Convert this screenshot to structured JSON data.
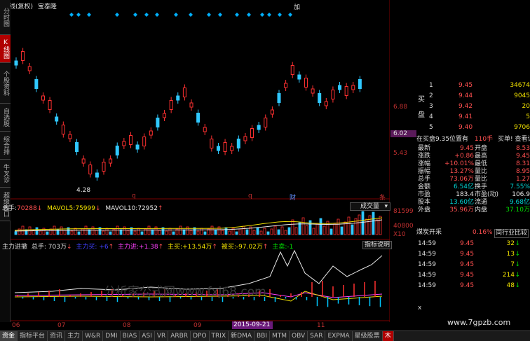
{
  "header": {
    "period_label": "日线(复权)",
    "stock_name": "宝泰隆",
    "add_button": "加"
  },
  "left_tabs": [
    {
      "label": "分时图",
      "active": false
    },
    {
      "label": "K线图",
      "active": true
    },
    {
      "label": "个股资料",
      "active": false
    },
    {
      "label": "自选股",
      "active": false
    },
    {
      "label": "综合排名",
      "active": false
    },
    {
      "label": "牛叉诊股",
      "active": false
    },
    {
      "label": "超级盘口",
      "active": false
    }
  ],
  "price_axis": {
    "levels": [
      "6.88",
      "6.02",
      "5.43"
    ],
    "current_price_highlight": "6.02",
    "low_marker": "4.28",
    "markers": [
      "q",
      "q",
      "财",
      "条"
    ]
  },
  "volume_panel": {
    "total_label": "总手:",
    "total_value": "70288",
    "mavol5_label": "MAVOL5:",
    "mavol5_value": "75999",
    "mavol10_label": "MAVOL10:",
    "mavol10_value": "72952",
    "dropdown": "成交量",
    "axis_top": "81599",
    "axis_mid": "40800",
    "axis_unit": "X10"
  },
  "indicator_panel": {
    "name": "主力进撤",
    "total": "总手: 703万",
    "main_inflow_label": "主力进:",
    "main_inflow_value": "+1.38",
    "active_buy_label": "主买:",
    "active_buy_value": "+13.54万",
    "passive_buy_label": "被买:",
    "passive_buy_value": "-97.02万",
    "main_sell_label": "主卖:",
    "main_sell_value": "-1",
    "help_button": "指标说明",
    "watermark": "分析家公式网www.fxj68.com"
  },
  "x_axis": {
    "labels": [
      "06",
      "07",
      "08",
      "09",
      "10",
      "11"
    ],
    "date_highlight": "2015-09-21"
  },
  "order_book": {
    "side_label_buy": "买",
    "side_label_sell": "卖",
    "rows": [
      {
        "n": "1",
        "price": "9.45",
        "vol": "34674"
      },
      {
        "n": "2",
        "price": "9.44",
        "vol": "9045"
      },
      {
        "n": "3",
        "price": "9.42",
        "vol": "20"
      },
      {
        "n": "4",
        "price": "9.41",
        "vol": "5"
      },
      {
        "n": "5",
        "price": "9.40",
        "vol": "9706"
      }
    ],
    "queue_text": "在买盘9.35位置有",
    "queue_vol": "110手",
    "queue_link": "买单! 查看详细"
  },
  "quote_stats": [
    {
      "l1": "最新",
      "v1": "9.45",
      "l2": "开盘",
      "v2": "8.53",
      "c1": "red",
      "c2": "red"
    },
    {
      "l1": "涨跌",
      "v1": "+0.86",
      "l2": "最高",
      "v2": "9.45",
      "c1": "red",
      "c2": "red"
    },
    {
      "l1": "涨幅",
      "v1": "+10.01%",
      "l2": "最低",
      "v2": "8.31",
      "c1": "red",
      "c2": "red"
    },
    {
      "l1": "振幅",
      "v1": "13.27%",
      "l2": "量比",
      "v2": "8.95",
      "c1": "red",
      "c2": "red"
    },
    {
      "l1": "总手",
      "v1": "73.06万",
      "l2": "量比",
      "v2": "1.27",
      "c1": "red",
      "c2": "red"
    },
    {
      "l1": "金额",
      "v1": "6.54亿",
      "l2": "换手",
      "v2": "7.55%",
      "c1": "cy",
      "c2": "cy"
    },
    {
      "l1": "市盈",
      "v1": "183.4",
      "l2": "市盈(动)",
      "v2": "106.9",
      "c1": "wht",
      "c2": "wht"
    },
    {
      "l1": "股本",
      "v1": "13.60亿",
      "l2": "流通",
      "v2": "9.68亿",
      "c1": "cy",
      "c2": "cy"
    },
    {
      "l1": "外盘",
      "v1": "35.96万",
      "l2": "内盘",
      "v2": "37.10万",
      "c1": "red",
      "c2": "grn"
    }
  ],
  "sector": {
    "name": "煤炭开采",
    "pct": "0.16%",
    "compare_button": "同行业比较"
  },
  "ticks": [
    {
      "t": "14:59",
      "p": "9.45",
      "v": "32",
      "d": "B"
    },
    {
      "t": "14:59",
      "p": "9.45",
      "v": "13",
      "d": "B"
    },
    {
      "t": "14:59",
      "p": "9.45",
      "v": "7",
      "d": "B"
    },
    {
      "t": "14:59",
      "p": "9.45",
      "v": "214",
      "d": "B"
    },
    {
      "t": "14:59",
      "p": "9.45",
      "v": "48",
      "d": "B"
    }
  ],
  "site_watermark": "www.7gpzb.com",
  "bottom_tabs": [
    "资金",
    "指标平台",
    "资讯",
    "主力",
    "W&R",
    "DMI",
    "BIAS",
    "ASI",
    "VR",
    "ARBR",
    "DPO",
    "TRIX",
    "新DMA",
    "BBI",
    "MTM",
    "OBV",
    "SAR",
    "EXPMA",
    "星级股票"
  ],
  "bottom_tabs_active": 0,
  "bottom_corner": "木"
}
